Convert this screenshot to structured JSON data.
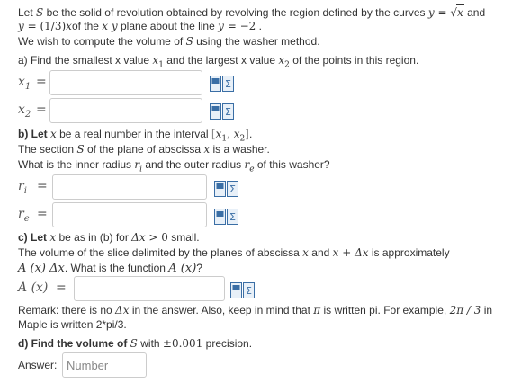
{
  "intro": {
    "t1": "Let ",
    "S": "S",
    "t2": " be the solid of revolution obtained by revolving the region defined by the curves ",
    "curve1_lhs": "y",
    "eq": " = ",
    "curve1_rhs": "x",
    "t3": " and",
    "curve2_lhs": "y",
    "curve2_rhs": "(1/3)",
    "curve2_x": "x",
    "t4": "of the ",
    "xy": "x y",
    "t5": " plane about the line ",
    "line_y": "y",
    "line_val": "−2",
    "t6": " .",
    "washer_a": "We wish to compute the volume of ",
    "washer_S": "S",
    "washer_b": " using the washer method."
  },
  "part_a": {
    "q_a": "a) Find the smallest x value ",
    "x1": "x",
    "x1_sub": "1",
    "q_b": " and the largest x value ",
    "x2": "x",
    "x2_sub": "2",
    "q_c": " of the points in this region.",
    "lbl_x1": "x",
    "lbl_x1_sub": "1",
    "lbl_x2": "x",
    "lbl_x2_sub": "2",
    "eq": "="
  },
  "part_b": {
    "q1a": "b) Let ",
    "x": "x",
    "q1b": " be a real number in the interval ",
    "int_open": "[",
    "int_x1": "x",
    "int_x1_sub": "1",
    "int_comma": ", ",
    "int_x2": "x",
    "int_x2_sub": "2",
    "int_close": "]",
    "q1c": ".",
    "q2a": "The section ",
    "S": "S",
    "q2b": " of the plane of abscissa ",
    "x2": "x",
    "q2c": " is a washer.",
    "q3a": "What is the inner radius ",
    "ri": "r",
    "ri_sub": "i",
    "q3b": " and the outer radius ",
    "re": "r",
    "re_sub": "e",
    "q3c": " of this washer?",
    "lbl_ri": "r",
    "lbl_ri_sub": "i",
    "lbl_re": "r",
    "lbl_re_sub": "e",
    "eq": "="
  },
  "part_c": {
    "q1a": "c) Let ",
    "x": "x",
    "q1b": " be as in (b) for ",
    "dx": "Δx",
    "gt": " > 0",
    "q1c": " small.",
    "q2a": "The volume of the slice delimited by the planes of abscissa ",
    "xa": "x",
    "q2b": " and ",
    "xb": "x + Δx",
    "q2c": " is approximately",
    "q3_A": "A",
    "q3_arg": " (x) ",
    "q3_dx": "Δx",
    "q3b": ". What is the function ",
    "q3_A2": "A",
    "q3_arg2": " (x)",
    "q3c": "?",
    "lbl_A": "A",
    "lbl_arg": " (x)",
    "eq": "=",
    "rem1a": "Remark: there is no ",
    "rem_dx": "Δx",
    "rem1b": " in the answer. Also, keep in mind that ",
    "pi": "π",
    "rem1c": " is written pi. For example, ",
    "ex": "2π / 3",
    "rem1d": " in",
    "rem2": "Maple is written 2*pi/3."
  },
  "part_d": {
    "qa": "d) Find the volume of ",
    "S": "S",
    "qb": " with ",
    "prec": "±0.001",
    "qc": " precision.",
    "answer_label": "Answer:",
    "answer_placeholder": "Number"
  },
  "colors": {
    "border": "#cccccc",
    "text": "#333333",
    "tool_blue": "#3a6ea5"
  },
  "icons": [
    "equation-editor-icon",
    "maple-tool-icon"
  ]
}
